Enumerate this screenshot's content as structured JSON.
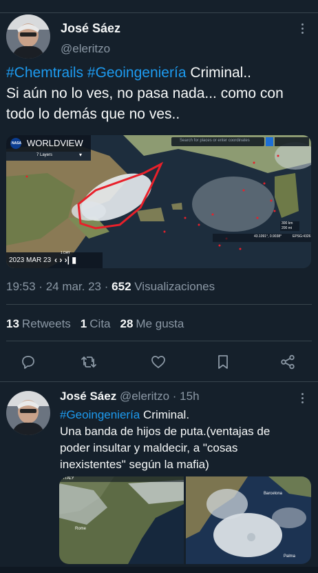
{
  "tweet": {
    "author_name": "José Sáez",
    "author_handle": "@eleritzo",
    "hashtag_1": "#Chemtrails",
    "hashtag_2": "#Geoingeniería",
    "text_line1_rest": "Criminal..",
    "text_rest": "Si aún no lo ves, no pasa nada... como con todo lo demás que no ves..",
    "media": {
      "brand": "WORLDVIEW",
      "nasa": "NASA",
      "layers": "7 Layers",
      "search_placeholder": "Search for places or enter coordinates",
      "date": "2023 MAR 23",
      "step": "1 DAY",
      "coords": "43.1091°, 0.9038°",
      "proj": "EPSG:4326",
      "scale_km": "300 km",
      "scale_mi": "200 mi"
    },
    "time": "19:53",
    "date": "24 mar. 23",
    "views_count": "652",
    "views_label": "Visualizaciones",
    "retweets_count": "13",
    "retweets_label": "Retweets",
    "quotes_count": "1",
    "quotes_label": "Cita",
    "likes_count": "28",
    "likes_label": "Me gusta"
  },
  "reply": {
    "author_name": "José Sáez",
    "author_handle": "@eleritzo",
    "time": "15h",
    "hashtag": "#Geoingeniería",
    "text_line1_rest": "Criminal.",
    "text_rest": "Una banda de hijos de puta.(ventajas de poder insultar y maldecir, a \"cosas inexistentes\" según la mafia)",
    "media_labels": {
      "left_top": "ITALY",
      "left_city": "Rome",
      "right_city": "Barcelona",
      "right_city2": "Palma"
    }
  },
  "separator": "·",
  "colors": {
    "background": "#15202b",
    "accent": "#1d9bf0",
    "muted": "#8b98a5",
    "border": "#38444d"
  }
}
